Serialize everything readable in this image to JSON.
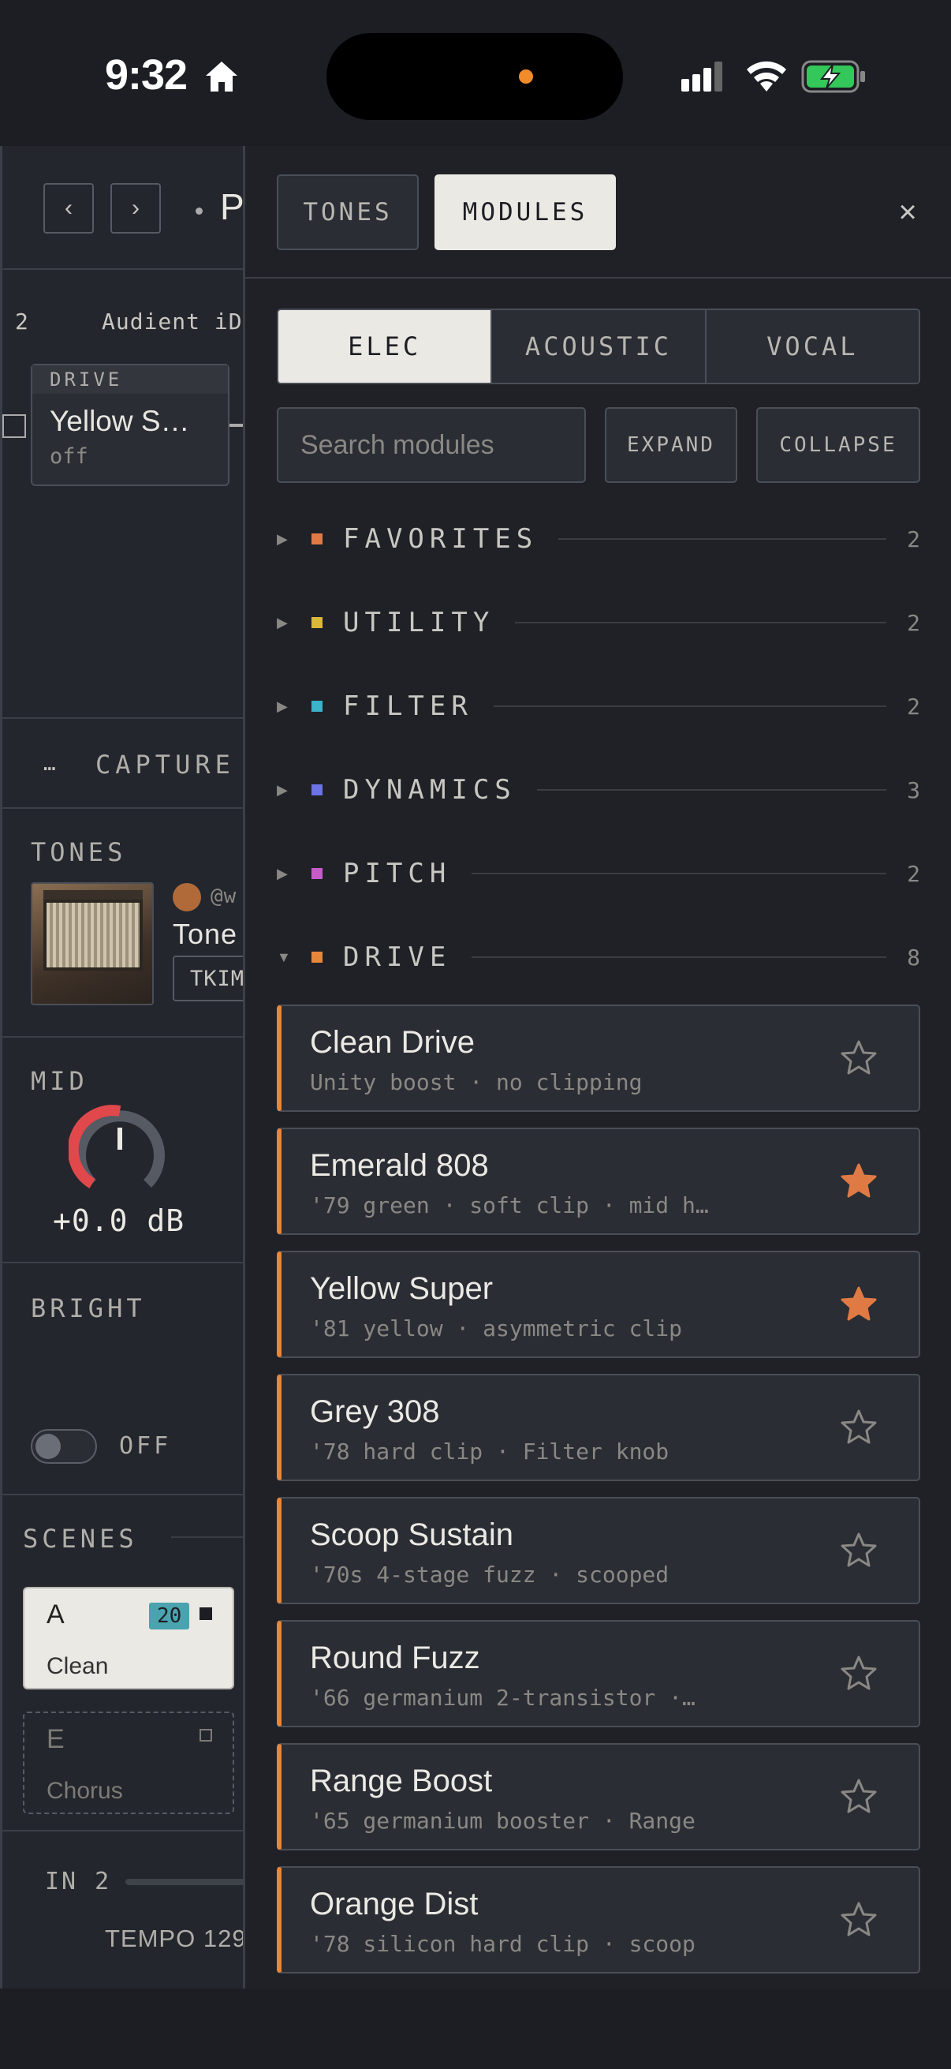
{
  "status": {
    "time": "9:32"
  },
  "bg": {
    "nav_prev": "‹",
    "nav_next": "›",
    "title": "P",
    "input_num": "2",
    "input_name": "Audient iD",
    "drive_header": "DRIVE",
    "drive_name": "Yellow S…",
    "drive_state": "off",
    "capture_label": "CAPTURE",
    "capture_icon": "…",
    "tones_label": "TONES",
    "tone_user": "@w",
    "tone_name": "Tone",
    "tone_tag": "TKIM",
    "mid_label": "MID",
    "mid_value": "+0.0 dB",
    "bright_label": "BRIGHT",
    "bright_state": "OFF",
    "scenes_label": "SCENES",
    "scene_a": {
      "letter": "A",
      "badge": "20",
      "name": "Clean"
    },
    "scene_e": {
      "letter": "E",
      "name": "Chorus"
    },
    "in_label": "IN 2",
    "tempo_label": "TEMPO 129"
  },
  "panel": {
    "tabs": [
      "TONES",
      "MODULES"
    ],
    "active_tab": "MODULES",
    "close": "×",
    "segments": [
      "ELEC",
      "ACOUSTIC",
      "VOCAL"
    ],
    "active_segment": "ELEC",
    "search_placeholder": "Search modules",
    "expand": "EXPAND",
    "collapse": "COLLAPSE",
    "categories": [
      {
        "name": "FAVORITES",
        "count": "2",
        "color": "#e07a45",
        "expanded": false
      },
      {
        "name": "UTILITY",
        "count": "2",
        "color": "#d9b83a",
        "expanded": false
      },
      {
        "name": "FILTER",
        "count": "2",
        "color": "#3bb3c9",
        "expanded": false
      },
      {
        "name": "DYNAMICS",
        "count": "3",
        "color": "#6b73e6",
        "expanded": false
      },
      {
        "name": "PITCH",
        "count": "2",
        "color": "#c65cc8",
        "expanded": false
      },
      {
        "name": "DRIVE",
        "count": "8",
        "color": "#e8863a",
        "expanded": true
      }
    ],
    "modules": [
      {
        "name": "Clean Drive",
        "desc": "Unity boost · no clipping",
        "favorite": false
      },
      {
        "name": "Emerald 808",
        "desc": "'79 green · soft clip · mid h…",
        "favorite": true
      },
      {
        "name": "Yellow Super",
        "desc": "'81 yellow · asymmetric clip",
        "favorite": true
      },
      {
        "name": "Grey 308",
        "desc": "'78 hard clip · Filter knob",
        "favorite": false
      },
      {
        "name": "Scoop Sustain",
        "desc": "'70s 4-stage fuzz · scooped",
        "favorite": false
      },
      {
        "name": "Round Fuzz",
        "desc": "'66 germanium 2-transistor ·…",
        "favorite": false
      },
      {
        "name": "Range Boost",
        "desc": "'65 germanium booster · Range",
        "favorite": false
      },
      {
        "name": "Orange Dist",
        "desc": "'78 silicon hard clip · scoop",
        "favorite": false
      }
    ],
    "accent": "#e8863a"
  }
}
